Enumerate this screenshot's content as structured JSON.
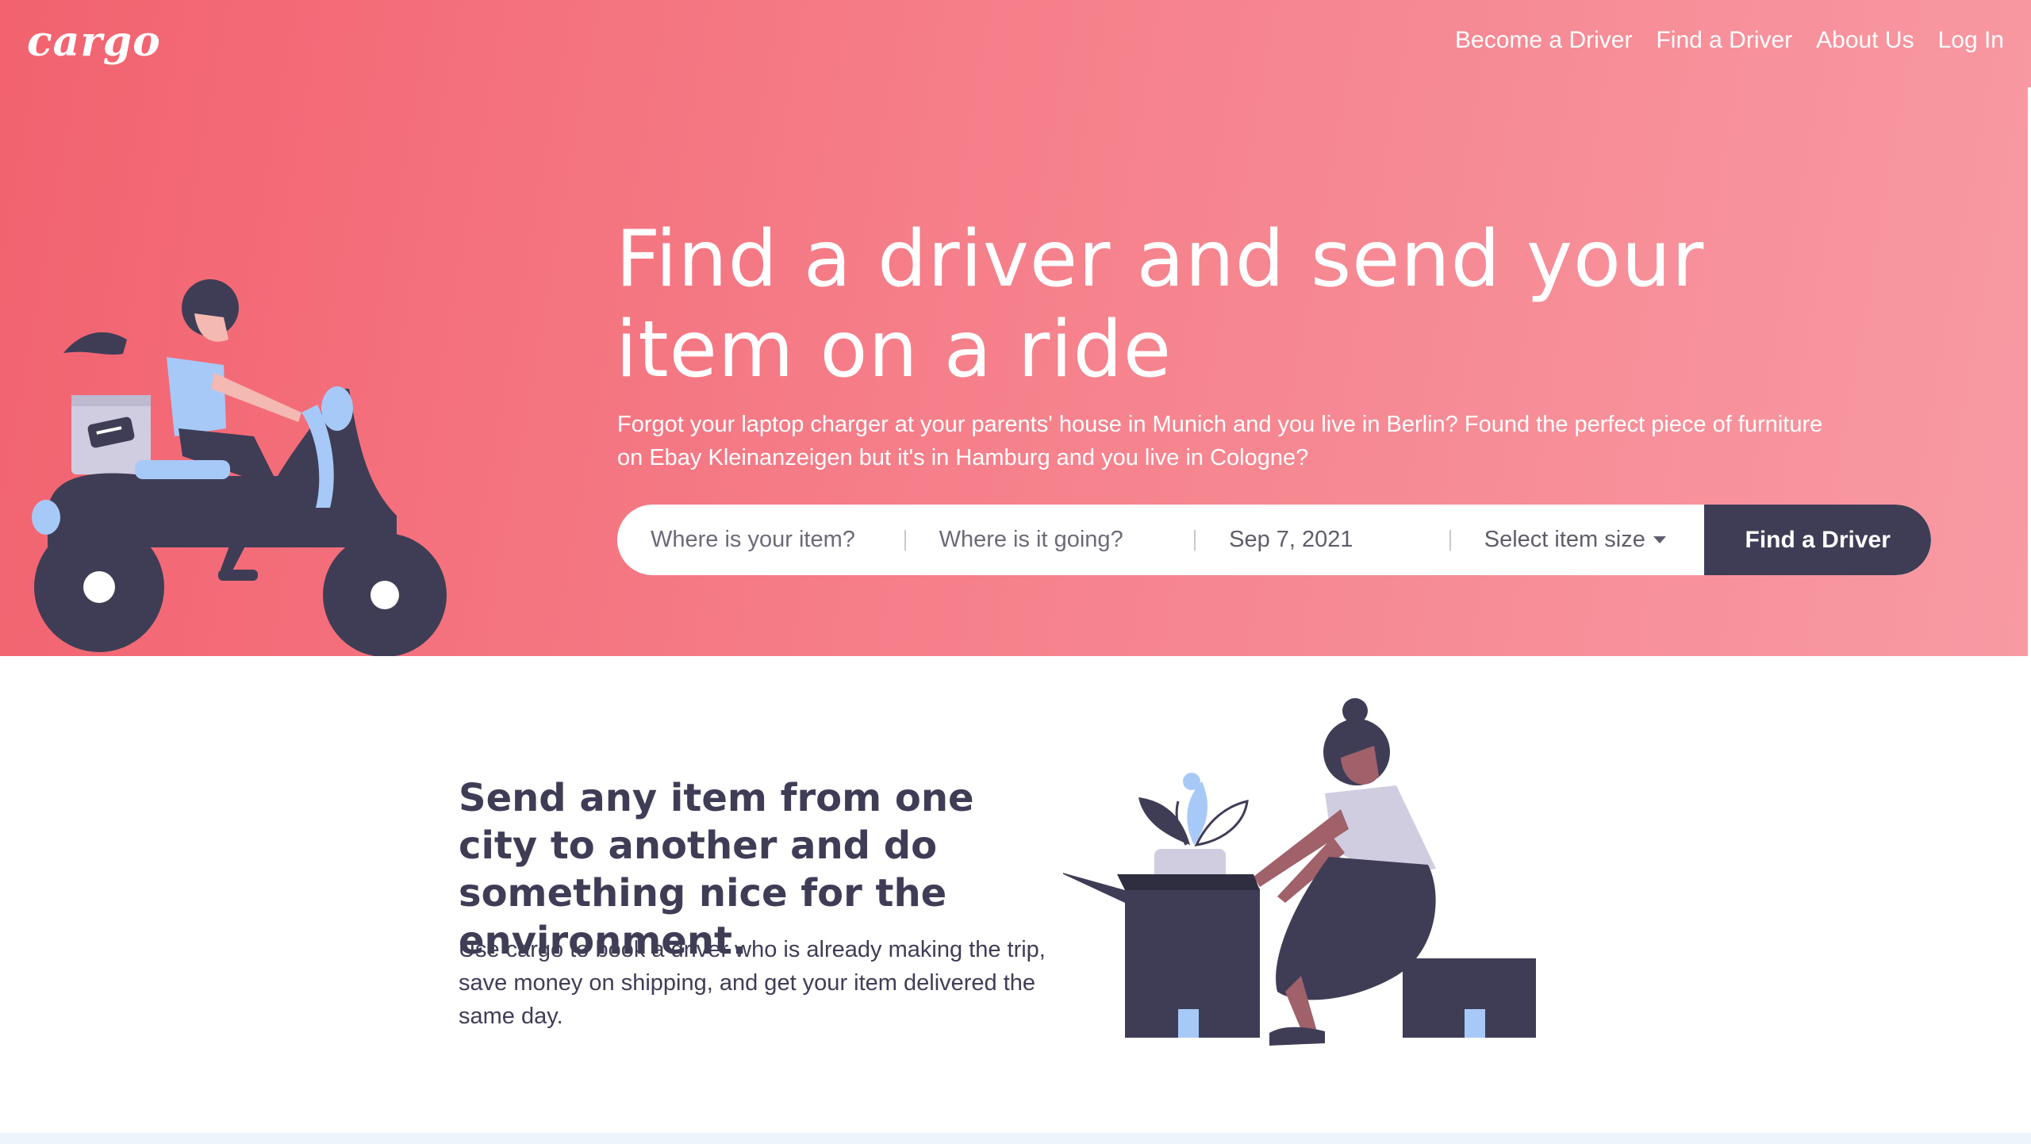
{
  "brand": {
    "logo_text": "cargo"
  },
  "nav": {
    "items": [
      {
        "label": "Become a Driver"
      },
      {
        "label": "Find a Driver"
      },
      {
        "label": "About Us"
      },
      {
        "label": "Log In"
      }
    ]
  },
  "hero": {
    "headline": "Find a driver and send your item on a ride",
    "subtext": "Forgot your laptop charger at your parents' house in Munich and you live in Berlin? Found the perfect piece of furniture on Ebay Kleinanzeigen but it's in Hamburg and you live in Cologne?"
  },
  "search": {
    "from_placeholder": "Where is your item?",
    "to_placeholder": "Where is it going?",
    "date_value": "Sep 7, 2021",
    "size_label": "Select item size",
    "button_label": "Find a Driver"
  },
  "feature": {
    "title": "Send any item from one city to another and do something nice for the environment.",
    "body": "Use cargo to book a driver who is already making the trip, save money on shipping, and get your item delivered the same day."
  },
  "colors": {
    "hero_gradient_start": "#f2626f",
    "hero_gradient_end": "#f89aa3",
    "primary_dark": "#3f3d56",
    "accent_blue": "#a7c9f7",
    "skin_dark": "#a0616a"
  },
  "icons": {
    "size_dropdown": "chevron-down-icon"
  }
}
